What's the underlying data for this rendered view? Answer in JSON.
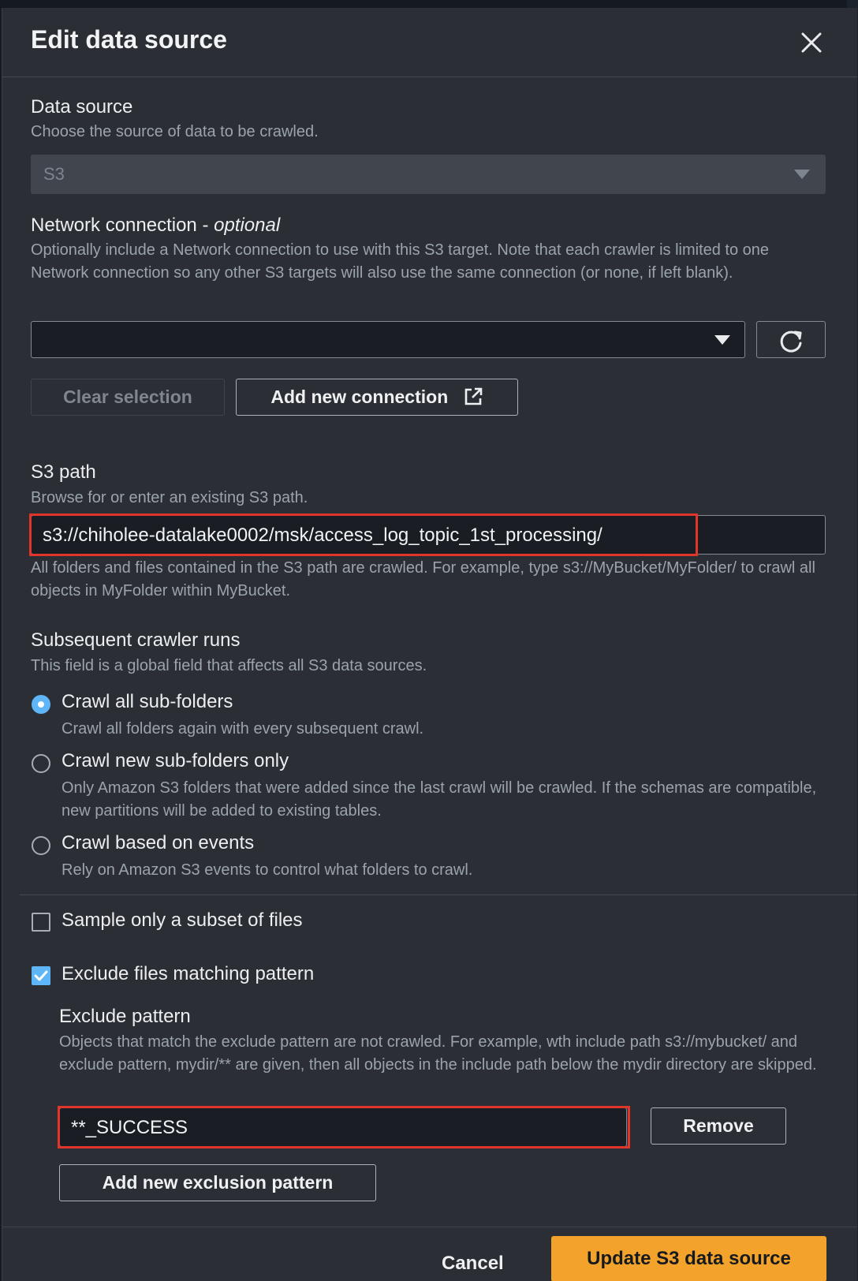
{
  "modal": {
    "title": "Edit data source",
    "close_icon": "close-icon"
  },
  "data_source": {
    "label": "Data source",
    "description": "Choose the source of data to be crawled.",
    "value": "S3"
  },
  "network": {
    "label": "Network connection - ",
    "label_optional": "optional",
    "description": "Optionally include a Network connection to use with this S3 target. Note that each crawler is limited to one Network connection so any other S3 targets will also use the same connection (or none, if left blank).",
    "value": "",
    "refresh_icon": "refresh-icon",
    "clear_label": "Clear selection",
    "add_label": "Add new connection",
    "external_icon": "external-link-icon"
  },
  "s3_path": {
    "label": "S3 path",
    "description": "Browse for or enter an existing S3 path.",
    "value": "s3://chiholee-datalake0002/msk/access_log_topic_1st_processing/",
    "hint": "All folders and files contained in the S3 path are crawled. For example, type s3://MyBucket/MyFolder/ to crawl all objects in MyFolder within MyBucket."
  },
  "subsequent": {
    "label": "Subsequent crawler runs",
    "description": "This field is a global field that affects all S3 data sources.",
    "options": [
      {
        "label": "Crawl all sub-folders",
        "description": "Crawl all folders again with every subsequent crawl.",
        "selected": true
      },
      {
        "label": "Crawl new sub-folders only",
        "description": "Only Amazon S3 folders that were added since the last crawl will be crawled. If the schemas are compatible, new partitions will be added to existing tables.",
        "selected": false
      },
      {
        "label": "Crawl based on events",
        "description": "Rely on Amazon S3 events to control what folders to crawl.",
        "selected": false
      }
    ]
  },
  "sample": {
    "label": "Sample only a subset of files",
    "checked": false
  },
  "exclude": {
    "label": "Exclude files matching pattern",
    "checked": true,
    "pattern_label": "Exclude pattern",
    "pattern_description": "Objects that match the exclude pattern are not crawled. For example, wth include path s3://mybucket/ and exclude pattern, mydir/** are given, then all objects in the include path below the mydir directory are skipped.",
    "pattern_value": "**_SUCCESS",
    "remove_label": "Remove",
    "add_label": "Add new exclusion pattern"
  },
  "footer": {
    "cancel_label": "Cancel",
    "submit_label": "Update S3 data source"
  },
  "colors": {
    "primary": "#f3a32b",
    "selected": "#5eb5f7",
    "highlight": "#e0352b",
    "modal_bg": "#2b2f35"
  }
}
